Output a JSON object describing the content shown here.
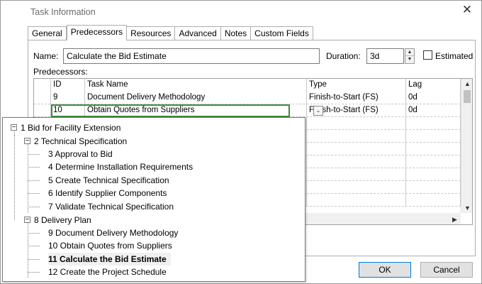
{
  "window": {
    "title": "Task Information",
    "close_glyph": "✕"
  },
  "tabs": [
    {
      "label": "General",
      "active": false
    },
    {
      "label": "Predecessors",
      "active": true
    },
    {
      "label": "Resources",
      "active": false
    },
    {
      "label": "Advanced",
      "active": false
    },
    {
      "label": "Notes",
      "active": false
    },
    {
      "label": "Custom Fields",
      "active": false
    }
  ],
  "form": {
    "name_label": "Name:",
    "name_value": "Calculate the Bid Estimate",
    "duration_label": "Duration:",
    "duration_value": "3d",
    "estimated_label": "Estimated",
    "estimated_checked": false,
    "predecessors_label": "Predecessors:"
  },
  "grid": {
    "columns": [
      "ID",
      "Task Name",
      "Type",
      "Lag"
    ],
    "rows": [
      {
        "id": "9",
        "name": "Document Delivery Methodology",
        "type": "Finish-to-Start (FS)",
        "lag": "0d"
      },
      {
        "id": "10",
        "name": "Obtain Quotes from Suppliers",
        "type": "Finish-to-Start (FS)",
        "lag": "0d"
      }
    ],
    "combo_glyph": "⌄"
  },
  "tree": [
    {
      "label": "1  Bid for Facility Extension",
      "level": 0,
      "expander": "−",
      "current": false
    },
    {
      "label": "2  Technical Specification",
      "level": 1,
      "expander": "−",
      "current": false
    },
    {
      "label": "3  Approval to Bid",
      "level": 2,
      "expander": "",
      "current": false
    },
    {
      "label": "4  Determine Installation Requirements",
      "level": 2,
      "expander": "",
      "current": false
    },
    {
      "label": "5  Create Technical Specification",
      "level": 2,
      "expander": "",
      "current": false
    },
    {
      "label": "6  Identify Supplier Components",
      "level": 2,
      "expander": "",
      "current": false
    },
    {
      "label": "7  Validate Technical Specification",
      "level": 2,
      "expander": "",
      "current": false
    },
    {
      "label": "8  Delivery Plan",
      "level": 1,
      "expander": "−",
      "current": false
    },
    {
      "label": "9  Document Delivery Methodology",
      "level": 2,
      "expander": "",
      "current": false
    },
    {
      "label": "10  Obtain Quotes from Suppliers",
      "level": 2,
      "expander": "",
      "current": false
    },
    {
      "label": "11  Calculate the Bid Estimate",
      "level": 2,
      "expander": "",
      "current": true
    },
    {
      "label": "12  Create the Project Schedule",
      "level": 2,
      "expander": "",
      "current": false
    }
  ],
  "buttons": {
    "ok": "OK",
    "cancel": "Cancel"
  },
  "colors": {
    "selection_border": "#3f8c3f",
    "ok_border": "#0078d7"
  }
}
